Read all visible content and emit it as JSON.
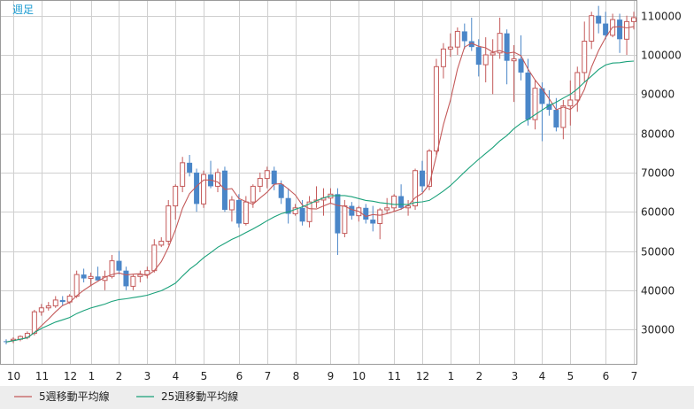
{
  "chart_data": {
    "type": "candlestick",
    "period_label": "週足",
    "y_ticks": [
      30000,
      40000,
      50000,
      60000,
      70000,
      80000,
      90000,
      100000,
      110000
    ],
    "ylim": [
      21000,
      114000
    ],
    "x_tick_labels": [
      "10",
      "11",
      "12",
      "1",
      "2",
      "3",
      "4",
      "5",
      "6",
      "7",
      "8",
      "9",
      "10",
      "11",
      "12",
      "1",
      "2",
      "3",
      "4",
      "5",
      "6",
      "7"
    ],
    "x_tick_indices": [
      1,
      5,
      9,
      12,
      16,
      20,
      24,
      28,
      33,
      37,
      41,
      46,
      50,
      55,
      59,
      63,
      67,
      72,
      76,
      80,
      85,
      89
    ],
    "candles": [
      [
        27000,
        27500,
        26200,
        26800
      ],
      [
        27200,
        28000,
        26500,
        27500
      ],
      [
        27500,
        28500,
        27000,
        28200
      ],
      [
        28000,
        29500,
        27500,
        29000
      ],
      [
        29000,
        35000,
        28500,
        34500
      ],
      [
        34500,
        36500,
        33500,
        35500
      ],
      [
        35500,
        37000,
        34800,
        36000
      ],
      [
        36000,
        38500,
        35500,
        37500
      ],
      [
        37500,
        38500,
        36000,
        37000
      ],
      [
        37000,
        39000,
        36500,
        38500
      ],
      [
        38500,
        45000,
        38000,
        44000
      ],
      [
        44000,
        45500,
        42000,
        43000
      ],
      [
        43000,
        44500,
        41000,
        43500
      ],
      [
        43500,
        46000,
        42500,
        42500
      ],
      [
        42500,
        45000,
        40000,
        43500
      ],
      [
        43500,
        49000,
        43000,
        47500
      ],
      [
        47500,
        50000,
        44000,
        45000
      ],
      [
        45000,
        46000,
        40000,
        41000
      ],
      [
        41000,
        44000,
        40000,
        43500
      ],
      [
        43500,
        45000,
        42000,
        44000
      ],
      [
        44000,
        46000,
        43000,
        45000
      ],
      [
        45000,
        53000,
        44500,
        51500
      ],
      [
        51500,
        53500,
        51000,
        52500
      ],
      [
        52500,
        63000,
        51500,
        61500
      ],
      [
        61500,
        67000,
        58000,
        66500
      ],
      [
        66500,
        74000,
        65000,
        72500
      ],
      [
        72500,
        74500,
        69000,
        70000
      ],
      [
        70000,
        71000,
        60000,
        62000
      ],
      [
        62000,
        70500,
        61000,
        69500
      ],
      [
        69500,
        73000,
        66000,
        66500
      ],
      [
        66500,
        71000,
        65000,
        70000
      ],
      [
        70500,
        71500,
        60000,
        60500
      ],
      [
        60500,
        64000,
        57500,
        63000
      ],
      [
        63000,
        64500,
        56000,
        57000
      ],
      [
        57000,
        64000,
        56500,
        62500
      ],
      [
        62500,
        67000,
        61000,
        66500
      ],
      [
        66500,
        70000,
        65000,
        68500
      ],
      [
        68500,
        71500,
        66000,
        70500
      ],
      [
        70500,
        71500,
        65500,
        67000
      ],
      [
        67000,
        68000,
        62000,
        63500
      ],
      [
        63500,
        66000,
        57000,
        59500
      ],
      [
        59500,
        62000,
        59000,
        61000
      ],
      [
        61000,
        63000,
        56500,
        57500
      ],
      [
        57500,
        64000,
        56000,
        62500
      ],
      [
        62500,
        66500,
        61000,
        63000
      ],
      [
        63000,
        66000,
        59000,
        63500
      ],
      [
        63500,
        66000,
        62000,
        64500
      ],
      [
        64500,
        66000,
        49000,
        54500
      ],
      [
        54500,
        63000,
        53500,
        61500
      ],
      [
        61500,
        62500,
        58000,
        59000
      ],
      [
        59000,
        61500,
        57500,
        61000
      ],
      [
        61000,
        62000,
        57000,
        58000
      ],
      [
        58000,
        61500,
        55000,
        57000
      ],
      [
        57000,
        61000,
        53000,
        60500
      ],
      [
        60500,
        63500,
        59500,
        61000
      ],
      [
        61000,
        64500,
        60000,
        64000
      ],
      [
        64000,
        67000,
        60500,
        61000
      ],
      [
        61000,
        63000,
        59000,
        61500
      ],
      [
        61500,
        71000,
        60500,
        70500
      ],
      [
        70500,
        73000,
        65000,
        66500
      ],
      [
        66500,
        76000,
        65500,
        75500
      ],
      [
        75500,
        99000,
        74500,
        97000
      ],
      [
        97000,
        103000,
        94000,
        101500
      ],
      [
        101500,
        105500,
        99500,
        102000
      ],
      [
        102000,
        107000,
        100000,
        106000
      ],
      [
        106000,
        108000,
        101500,
        103500
      ],
      [
        103500,
        109500,
        101000,
        102000
      ],
      [
        102000,
        104000,
        94500,
        97500
      ],
      [
        97500,
        104500,
        93000,
        100000
      ],
      [
        100000,
        104000,
        90000,
        100500
      ],
      [
        100500,
        109500,
        99000,
        105500
      ],
      [
        105500,
        106500,
        92500,
        98500
      ],
      [
        98500,
        102500,
        88000,
        99000
      ],
      [
        99000,
        105000,
        93500,
        95500
      ],
      [
        95500,
        99000,
        82000,
        83500
      ],
      [
        83500,
        93500,
        81000,
        91500
      ],
      [
        91500,
        93000,
        78000,
        87500
      ],
      [
        87500,
        91000,
        84500,
        86000
      ],
      [
        86000,
        89000,
        80500,
        81500
      ],
      [
        81500,
        88500,
        78500,
        87000
      ],
      [
        87000,
        93500,
        82000,
        88500
      ],
      [
        88500,
        97000,
        85500,
        95500
      ],
      [
        95500,
        108500,
        93000,
        103500
      ],
      [
        103500,
        111000,
        101500,
        110000
      ],
      [
        110000,
        112500,
        105500,
        108000
      ],
      [
        108000,
        111000,
        104000,
        105000
      ],
      [
        105000,
        110500,
        104500,
        109000
      ],
      [
        109000,
        110500,
        100500,
        104000
      ],
      [
        104000,
        110000,
        100000,
        108500
      ],
      [
        108500,
        111000,
        106500,
        109500
      ]
    ],
    "series": [
      {
        "name": "5週移動平均線",
        "color": "#c45a5a",
        "type": "ma",
        "period": 5
      },
      {
        "name": "25週移動平均線",
        "color": "#1aa17a",
        "type": "ma",
        "period": 25
      }
    ],
    "up_color": "#c45a5a",
    "down_color": "#4a86c8",
    "grid": true
  }
}
